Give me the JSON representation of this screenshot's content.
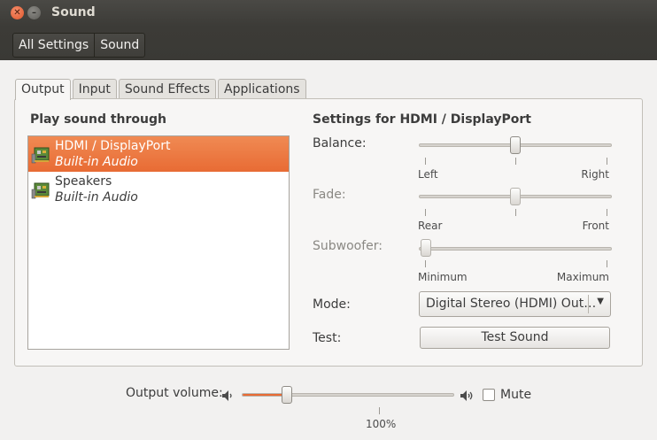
{
  "window": {
    "title": "Sound"
  },
  "titlebar": {
    "close_glyph": "✕",
    "minimize_glyph": "–"
  },
  "toolbar": {
    "crumbs": [
      "All Settings",
      "Sound"
    ]
  },
  "tabs": [
    {
      "label": "Output",
      "active": true
    },
    {
      "label": "Input",
      "active": false
    },
    {
      "label": "Sound Effects",
      "active": false
    },
    {
      "label": "Applications",
      "active": false
    }
  ],
  "output": {
    "list_title": "Play sound through",
    "devices": [
      {
        "name": "HDMI / DisplayPort",
        "sub": "Built-in Audio",
        "icon": "sound-card-icon",
        "selected": true
      },
      {
        "name": "Speakers",
        "sub": "Built-in Audio",
        "icon": "sound-card-icon",
        "selected": false
      }
    ],
    "settings_title": "Settings for HDMI / DisplayPort",
    "balance": {
      "label": "Balance:",
      "min_label": "Left",
      "max_label": "Right",
      "value": 0.5
    },
    "fade": {
      "label": "Fade:",
      "min_label": "Rear",
      "max_label": "Front",
      "value": 0.5
    },
    "subwoofer": {
      "label": "Subwoofer:",
      "min_label": "Minimum",
      "max_label": "Maximum",
      "value": 0.0
    },
    "mode": {
      "label": "Mode:",
      "selected": "Digital Stereo (HDMI) Out…",
      "arrow_glyph": "▼"
    },
    "test": {
      "label": "Test:",
      "button": "Test Sound"
    }
  },
  "volume": {
    "label": "Output volume:",
    "percent_label": "100%",
    "value": 0.19,
    "mute_label": "Mute",
    "muted": false
  },
  "colors": {
    "accent": "#e86b34",
    "titlebar": "#3c3b37",
    "background": "#f2f1f0"
  }
}
